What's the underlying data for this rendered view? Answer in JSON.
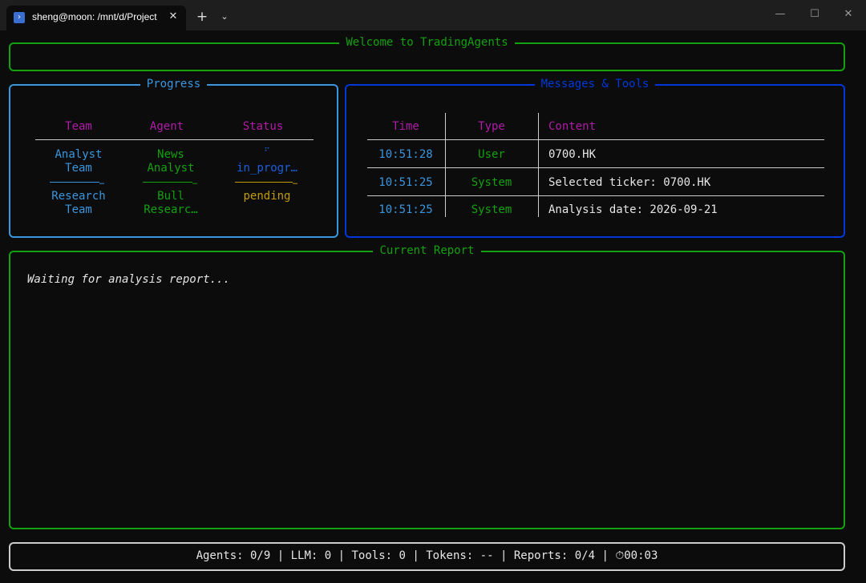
{
  "titlebar": {
    "tab_title": "sheng@moon: /mnt/d/Project",
    "tab_icon": "powershell-icon",
    "close": "✕",
    "new_tab": "+",
    "dropdown": "⌄",
    "minimize": "—",
    "maximize": "☐",
    "window_close": "✕"
  },
  "welcome": {
    "title": "Welcome to TradingAgents"
  },
  "progress": {
    "title": "Progress",
    "headers": {
      "team": "Team",
      "agent": "Agent",
      "status": "Status"
    },
    "rows": [
      {
        "team_line1": "Analyst",
        "team_line2": "Team",
        "agent_line1": "News",
        "agent_line2": "Analyst",
        "spinner": "⠋",
        "status": "in_progr…"
      },
      {
        "team_line1": "Research",
        "team_line2": "Team",
        "agent_line1": "Bull",
        "agent_line2": "Researc…",
        "status": "pending"
      }
    ],
    "ellipsis": "…"
  },
  "messages": {
    "title": "Messages & Tools",
    "headers": {
      "time": "Time",
      "type": "Type",
      "content": "Content"
    },
    "rows": [
      {
        "time": "10:51:28",
        "type": "User",
        "content": "0700.HK"
      },
      {
        "time": "10:51:25",
        "type": "System",
        "content": "Selected ticker: 0700.HK"
      },
      {
        "time": "10:51:25",
        "type": "System",
        "content": "Analysis date: 2026-09-21"
      }
    ]
  },
  "report": {
    "title": "Current Report",
    "text": "Waiting for analysis report..."
  },
  "footer": {
    "agents": "Agents: 0/9",
    "llm": "LLM: 0",
    "tools": "Tools: 0",
    "tokens": "Tokens: --",
    "reports": "Reports: 0/4",
    "timer_icon": "⏱",
    "timer": "00:03",
    "sep": "|"
  },
  "colors": {
    "green": "#13a10e",
    "blue": "#3a96dd",
    "dark_blue": "#0037da",
    "magenta": "#b01ca8",
    "yellow": "#c19c00",
    "background": "#0c0c0c"
  }
}
